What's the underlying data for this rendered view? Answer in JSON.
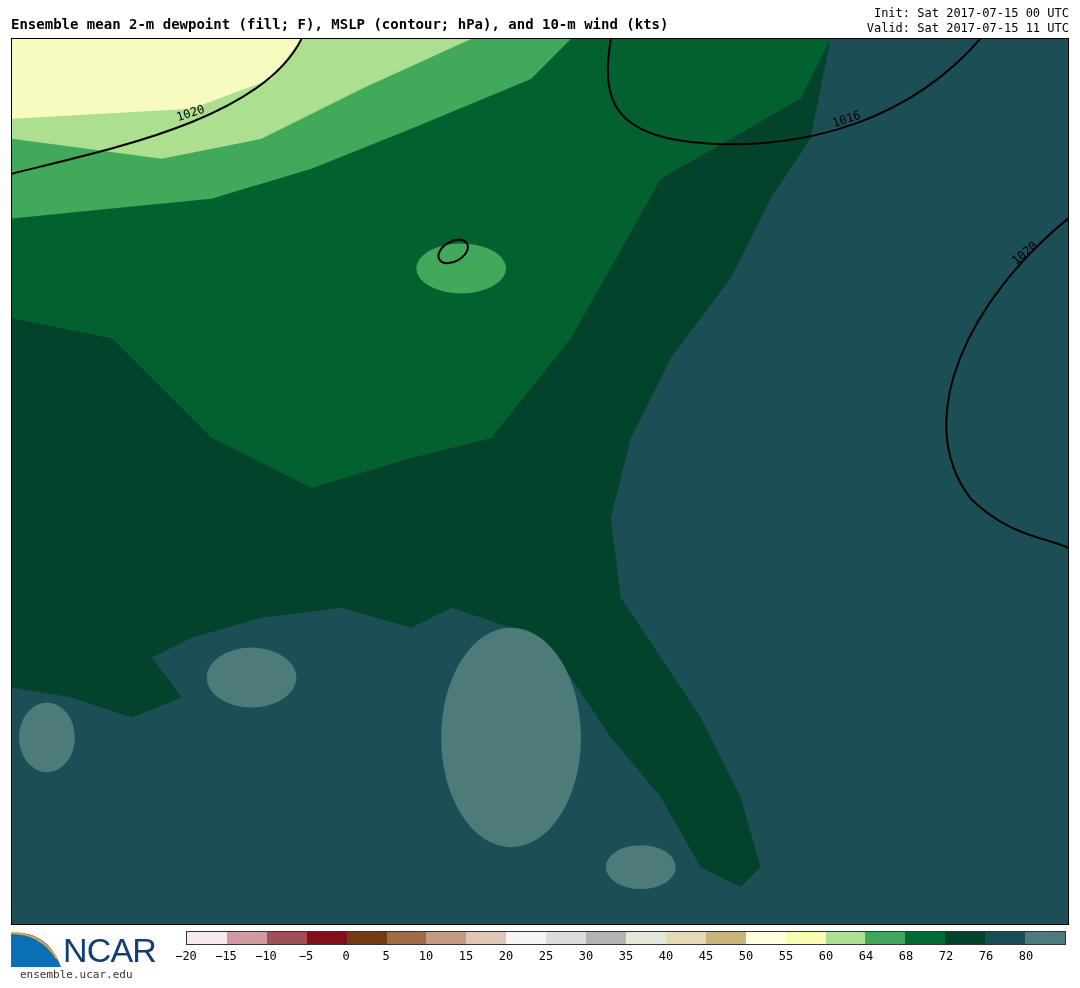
{
  "header": {
    "title": "Ensemble mean 2-m dewpoint (fill; F), MSLP (contour; hPa), and 10-m wind (kts)",
    "init": "Init: Sat 2017-07-15 00 UTC",
    "valid": "Valid: Sat 2017-07-15 11 UTC"
  },
  "map": {
    "contour_labels": [
      "1020",
      "1016",
      "1020"
    ]
  },
  "footer": {
    "logo": "NCAR",
    "site": "ensemble.ucar.edu"
  },
  "colorbar": [
    {
      "label": "−20",
      "color": "#f7e8ec"
    },
    {
      "label": "−15",
      "color": "#d09aa0"
    },
    {
      "label": "−10",
      "color": "#a34d57"
    },
    {
      "label": "−5",
      "color": "#820f1c"
    },
    {
      "label": "0",
      "color": "#7a3a10"
    },
    {
      "label": "5",
      "color": "#a16a45"
    },
    {
      "label": "10",
      "color": "#c49a80"
    },
    {
      "label": "15",
      "color": "#e0c6b6"
    },
    {
      "label": "20",
      "color": "#f5f5f5"
    },
    {
      "label": "25",
      "color": "#dcdcdc"
    },
    {
      "label": "30",
      "color": "#b3b3b3"
    },
    {
      "label": "35",
      "color": "#e4e8da"
    },
    {
      "label": "40",
      "color": "#e6dab4"
    },
    {
      "label": "45",
      "color": "#c9b577"
    },
    {
      "label": "50",
      "color": "#fefee0"
    },
    {
      "label": "55",
      "color": "#f8fcb0"
    },
    {
      "label": "60",
      "color": "#acdf90"
    },
    {
      "label": "64",
      "color": "#3fa65a"
    },
    {
      "label": "68",
      "color": "#006b35"
    },
    {
      "label": "72",
      "color": "#00432b"
    },
    {
      "label": "76",
      "color": "#1a4e55"
    },
    {
      "label": "80",
      "color": "#4d7a7c"
    }
  ]
}
